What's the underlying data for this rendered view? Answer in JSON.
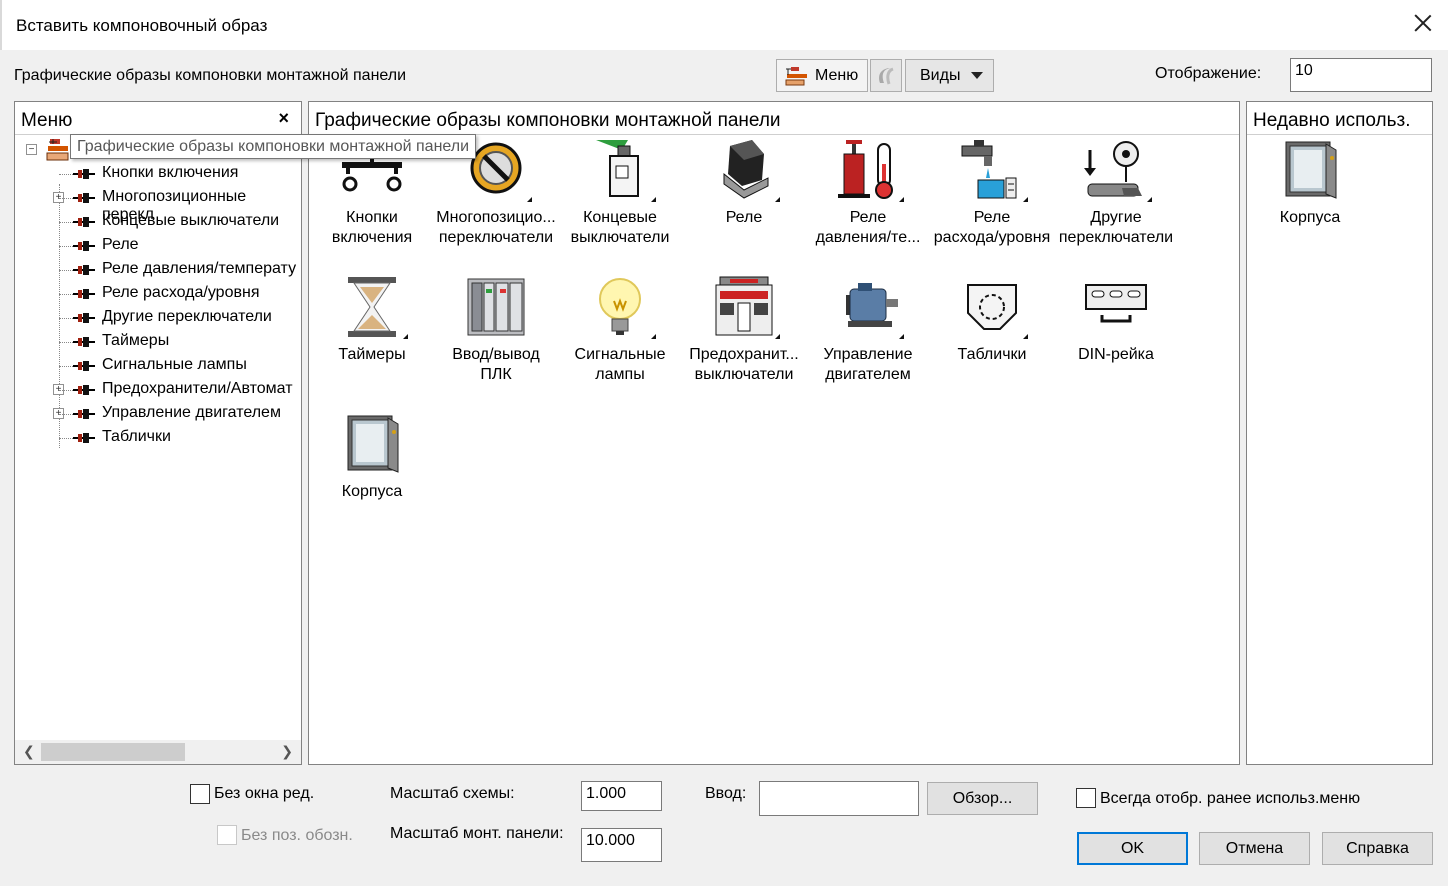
{
  "window": {
    "title": "Вставить компоновочный образ"
  },
  "toolbar": {
    "subtitle": "Графические образы компоновки монтажной панели",
    "menu_label": "Меню",
    "views_label": "Виды",
    "display_label": "Отображение:",
    "display_value": "10"
  },
  "menu_panel": {
    "title": "Меню",
    "close": "×",
    "tooltip": "Графические образы компоновки монтажной панели",
    "items": [
      "Кнопки включения",
      "Многопозиционные перекл",
      "Концевые выключатели",
      "Реле",
      "Реле давления/температу",
      "Реле расхода/уровня",
      "Другие переключатели",
      "Таймеры",
      "Сигнальные лампы",
      "Предохранители/Автомат",
      "Управление двигателем",
      "Таблички"
    ]
  },
  "content": {
    "title": "Графические образы компоновки монтажной панели",
    "tiles": [
      {
        "label1": "Кнопки",
        "label2": "включения",
        "icon": "pushbutton-icon",
        "more": false
      },
      {
        "label1": "Многопозицио...",
        "label2": "переключатели",
        "icon": "selector-switch-icon",
        "more": true
      },
      {
        "label1": "Концевые",
        "label2": "выключатели",
        "icon": "limit-switch-icon",
        "more": true
      },
      {
        "label1": "Реле",
        "label2": "",
        "icon": "relay-icon",
        "more": true
      },
      {
        "label1": "Реле",
        "label2": "давления/те...",
        "icon": "pressure-temperature-icon",
        "more": true
      },
      {
        "label1": "Реле",
        "label2": "расхода/уровня",
        "icon": "flow-level-icon",
        "more": true
      },
      {
        "label1": "Другие",
        "label2": "переключатели",
        "icon": "other-switches-icon",
        "more": true
      },
      {
        "label1": "Таймеры",
        "label2": "",
        "icon": "hourglass-icon",
        "more": true
      },
      {
        "label1": "Ввод/вывод",
        "label2": "ПЛК",
        "icon": "plc-io-icon",
        "more": false
      },
      {
        "label1": "Сигнальные",
        "label2": "лампы",
        "icon": "light-bulb-icon",
        "more": true
      },
      {
        "label1": "Предохранит...",
        "label2": "выключатели",
        "icon": "fuse-icon",
        "more": true
      },
      {
        "label1": "Управление",
        "label2": "двигателем",
        "icon": "motor-icon",
        "more": true
      },
      {
        "label1": "Таблички",
        "label2": "",
        "icon": "nameplate-icon",
        "more": true
      },
      {
        "label1": "DIN-рейка",
        "label2": "",
        "icon": "din-rail-icon",
        "more": false
      },
      {
        "label1": "Корпуса",
        "label2": "",
        "icon": "enclosure-icon",
        "more": false
      }
    ]
  },
  "recent_panel": {
    "title": "Недавно использ.",
    "items": [
      {
        "label": "Корпуса",
        "icon": "enclosure-icon"
      }
    ]
  },
  "footer": {
    "no_edit_window": "Без окна ред.",
    "no_pos_designation": "Без поз. обозн.",
    "schematic_scale_label": "Масштаб схемы:",
    "schematic_scale_value": "1.000",
    "panel_scale_label": "Масштаб монт. панели:",
    "panel_scale_value": "10.000",
    "input_label": "Ввод:",
    "input_value": "",
    "browse": "Обзор...",
    "always_show_recent": "Всегда отобр. ранее использ.меню",
    "ok": "OK",
    "cancel": "Отмена",
    "help": "Справка"
  }
}
